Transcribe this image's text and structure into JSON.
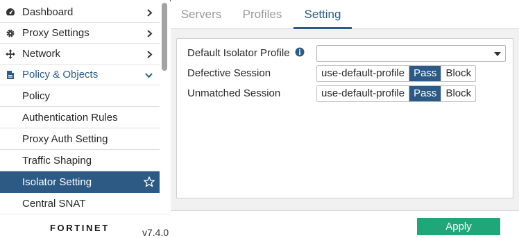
{
  "sidebar": {
    "items": [
      {
        "label": "Dashboard",
        "icon": "dashboard-icon"
      },
      {
        "label": "Proxy Settings",
        "icon": "gear-icon"
      },
      {
        "label": "Network",
        "icon": "network-arrows-icon"
      },
      {
        "label": "Policy & Objects",
        "icon": "policy-icon",
        "expanded": true
      }
    ],
    "subitems": [
      {
        "label": "Policy"
      },
      {
        "label": "Authentication Rules"
      },
      {
        "label": "Proxy Auth Setting"
      },
      {
        "label": "Traffic Shaping"
      },
      {
        "label": "Isolator Setting",
        "active": true
      },
      {
        "label": "Central SNAT"
      }
    ],
    "logo_text": "FORTINET",
    "version": "v7.4.0"
  },
  "tabs": [
    {
      "label": "Servers"
    },
    {
      "label": "Profiles"
    },
    {
      "label": "Setting",
      "active": true
    }
  ],
  "form": {
    "default_profile": {
      "label": "Default Isolator Profile",
      "value": ""
    },
    "defective_session": {
      "label": "Defective Session",
      "options": [
        "use-default-profile",
        "Pass",
        "Block"
      ],
      "selected": "Pass"
    },
    "unmatched_session": {
      "label": "Unmatched Session",
      "options": [
        "use-default-profile",
        "Pass",
        "Block"
      ],
      "selected": "Pass"
    }
  },
  "apply_label": "Apply",
  "colors": {
    "accent": "#2c5a84",
    "apply": "#21a67a"
  }
}
